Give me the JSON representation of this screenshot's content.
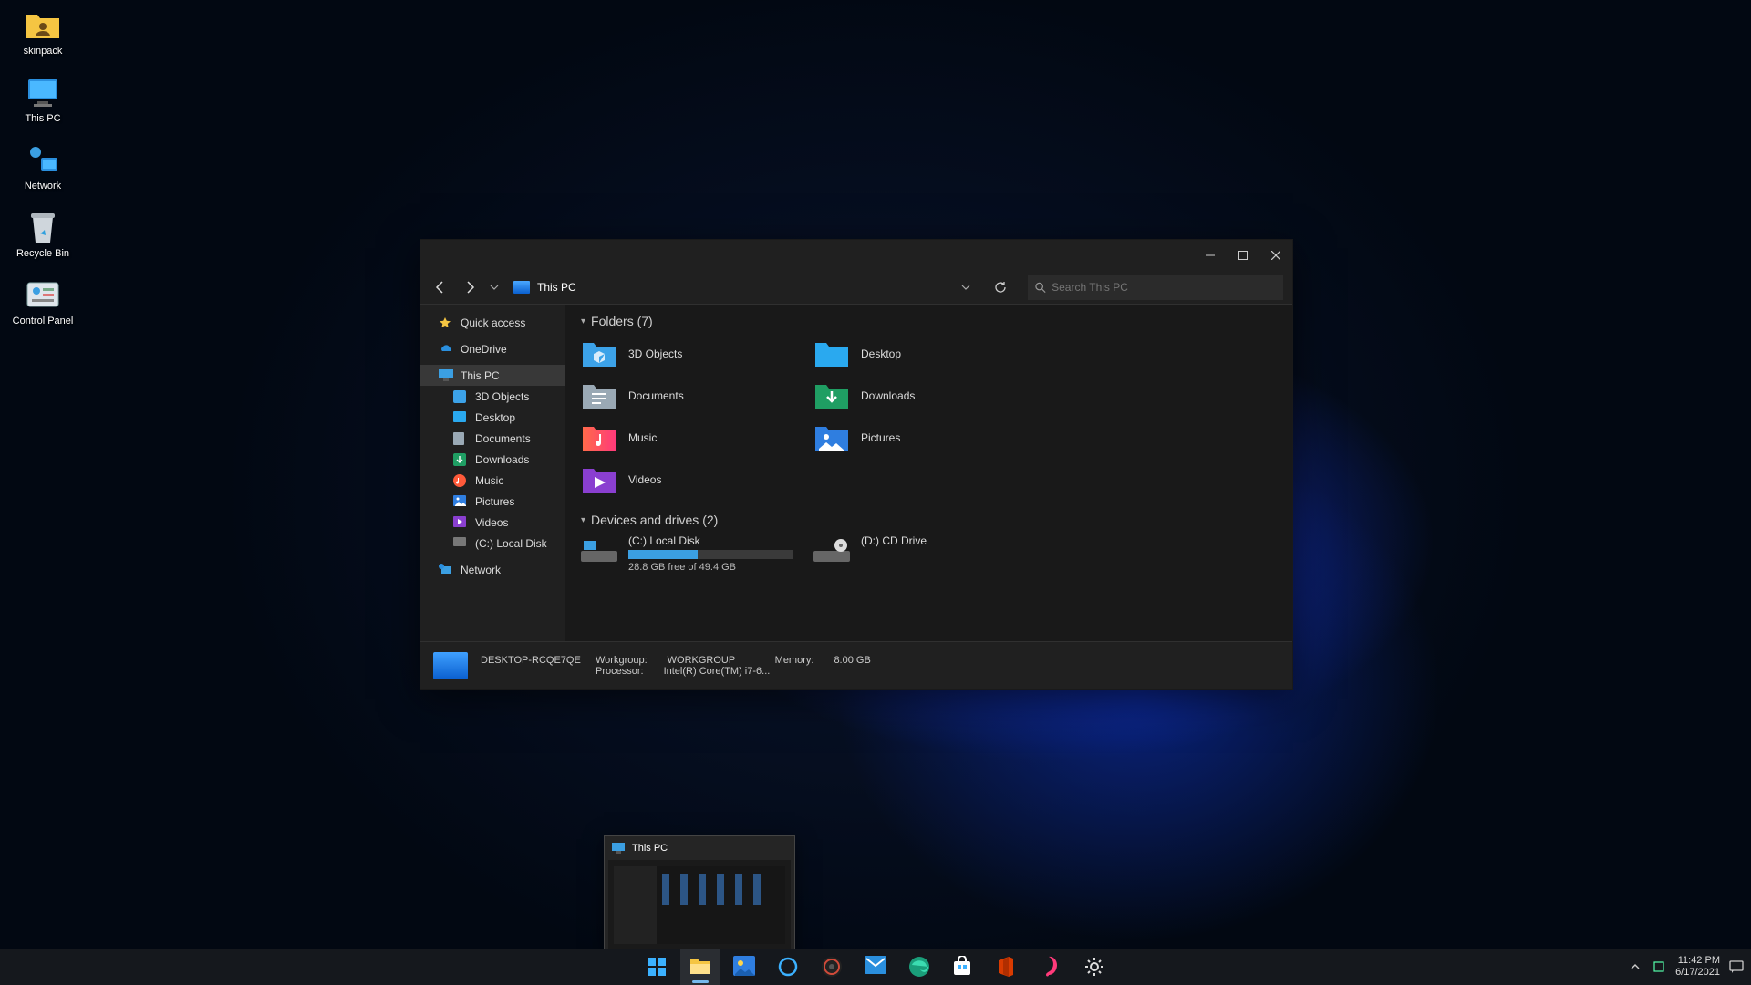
{
  "desktop_icons": [
    {
      "name": "skinpack",
      "icon": "folder-user"
    },
    {
      "name": "This PC",
      "icon": "this-pc"
    },
    {
      "name": "Network",
      "icon": "network"
    },
    {
      "name": "Recycle Bin",
      "icon": "recycle-bin"
    },
    {
      "name": "Control Panel",
      "icon": "control-panel"
    }
  ],
  "explorer": {
    "title": "This PC",
    "search_placeholder": "Search This PC",
    "sidebar": [
      {
        "label": "Quick access",
        "icon": "star",
        "indent": false,
        "sel": false
      },
      {
        "label": "OneDrive",
        "icon": "onedrive",
        "indent": false,
        "sel": false,
        "group": true
      },
      {
        "label": "This PC",
        "icon": "this-pc",
        "indent": false,
        "sel": true,
        "group": true
      },
      {
        "label": "3D Objects",
        "icon": "3d",
        "indent": true,
        "sel": false
      },
      {
        "label": "Desktop",
        "icon": "desktop",
        "indent": true,
        "sel": false
      },
      {
        "label": "Documents",
        "icon": "documents",
        "indent": true,
        "sel": false
      },
      {
        "label": "Downloads",
        "icon": "downloads",
        "indent": true,
        "sel": false
      },
      {
        "label": "Music",
        "icon": "music",
        "indent": true,
        "sel": false
      },
      {
        "label": "Pictures",
        "icon": "pictures",
        "indent": true,
        "sel": false
      },
      {
        "label": "Videos",
        "icon": "videos",
        "indent": true,
        "sel": false
      },
      {
        "label": "(C:) Local Disk",
        "icon": "disk",
        "indent": true,
        "sel": false
      },
      {
        "label": "Network",
        "icon": "network",
        "indent": false,
        "sel": false,
        "group": true
      }
    ],
    "folders_header": "Folders (7)",
    "folders": [
      {
        "label": "3D Objects",
        "color": "#3ca2e8"
      },
      {
        "label": "Desktop",
        "color": "#2aa9ef"
      },
      {
        "label": "Documents",
        "color": "#9aa9b5"
      },
      {
        "label": "Downloads",
        "color": "#1f9e63"
      },
      {
        "label": "Music",
        "color": "#ff7a4a"
      },
      {
        "label": "Pictures",
        "color": "#2f7ee0"
      },
      {
        "label": "Videos",
        "color": "#8a3fd0"
      }
    ],
    "drives_header": "Devices and drives (2)",
    "drives": [
      {
        "label": "(C:) Local Disk",
        "free_text": "28.8 GB free of 49.4 GB",
        "has_bar": true
      },
      {
        "label": "(D:) CD Drive",
        "free_text": "",
        "has_bar": false
      }
    ],
    "status": {
      "computer_name": "DESKTOP-RCQE7QE",
      "workgroup_label": "Workgroup:",
      "workgroup": "WORKGROUP",
      "processor_label": "Processor:",
      "processor": "Intel(R) Core(TM) i7-6...",
      "memory_label": "Memory:",
      "memory": "8.00 GB"
    }
  },
  "thumbnail": {
    "title": "This PC"
  },
  "taskbar": {
    "apps": [
      {
        "name": "start",
        "active": false
      },
      {
        "name": "explorer",
        "active": true
      },
      {
        "name": "photos",
        "active": false
      },
      {
        "name": "cortana",
        "active": false
      },
      {
        "name": "groove",
        "active": false
      },
      {
        "name": "mail",
        "active": false
      },
      {
        "name": "edge",
        "active": false
      },
      {
        "name": "store",
        "active": false
      },
      {
        "name": "office",
        "active": false
      },
      {
        "name": "paint",
        "active": false
      },
      {
        "name": "settings",
        "active": false
      }
    ],
    "time": "11:42 PM",
    "date": "6/17/2021"
  }
}
